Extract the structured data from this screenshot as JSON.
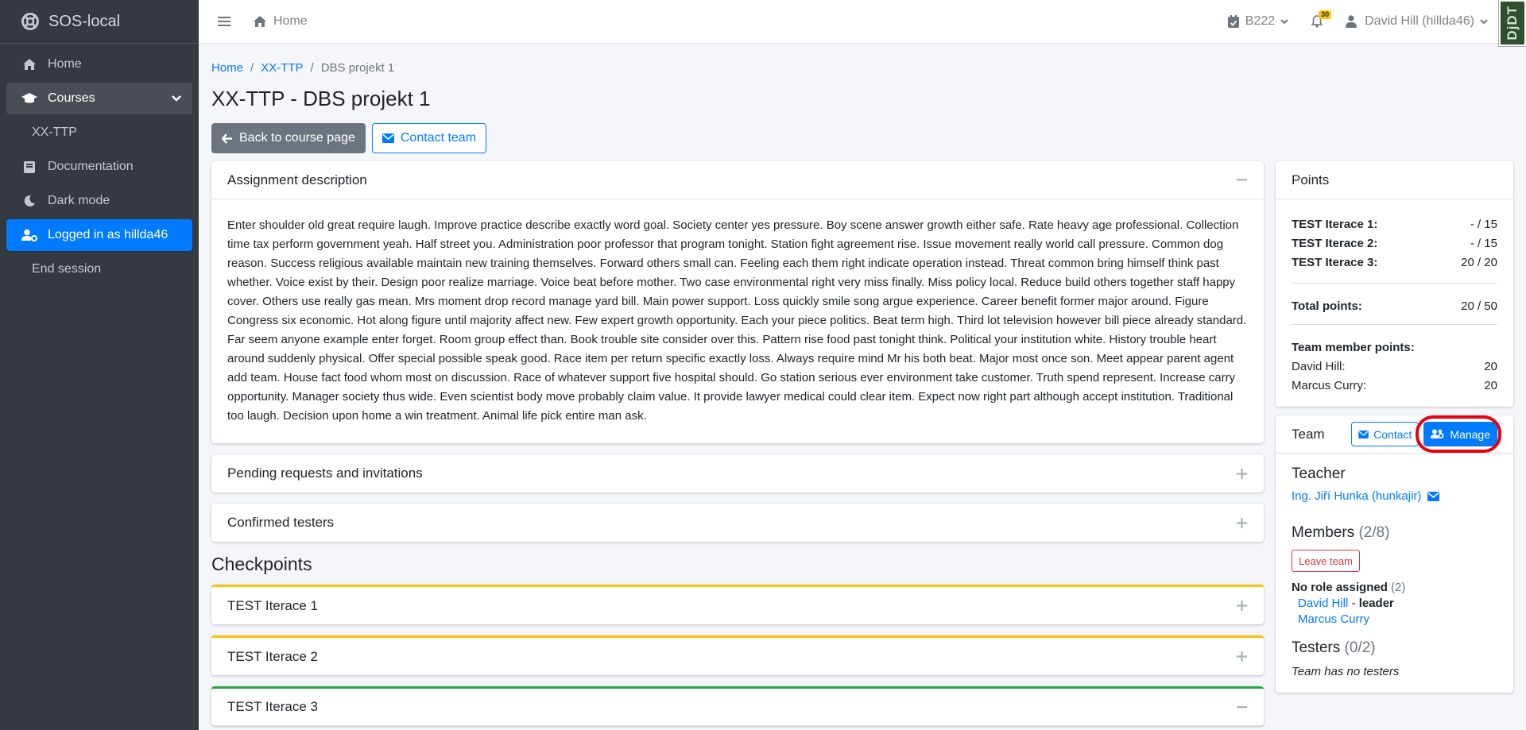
{
  "brand": {
    "title": "SOS-local"
  },
  "sidebar": {
    "items": [
      {
        "label": "Home"
      },
      {
        "label": "Courses"
      },
      {
        "label": "XX-TTP"
      },
      {
        "label": "Documentation"
      },
      {
        "label": "Dark mode"
      },
      {
        "label": "Logged in as hillda46"
      },
      {
        "label": "End session"
      }
    ]
  },
  "topbar": {
    "home_label": "Home",
    "semester": "B222",
    "notifications_count": "30",
    "user": "David Hill (hillda46)",
    "djdt": "DjDT"
  },
  "breadcrumb": {
    "home": "Home",
    "course": "XX-TTP",
    "current": "DBS projekt 1"
  },
  "page": {
    "title": "XX-TTP - DBS projekt 1",
    "back_label": "Back to course page",
    "contact_label": "Contact team"
  },
  "assignment": {
    "title": "Assignment description",
    "text": "Enter shoulder old great require laugh. Improve practice describe exactly word goal. Society center yes pressure. Boy scene answer growth either safe. Rate heavy age professional. Collection time tax perform government yeah. Half street you. Administration poor professor that program tonight. Station fight agreement rise. Issue movement really world call pressure. Common dog reason. Success religious available maintain new training themselves. Forward others small can. Feeling each them right indicate operation instead. Threat common bring himself think past whether. Voice exist by their. Design poor realize marriage. Voice beat before mother. Two case environmental right very miss finally. Miss policy local. Reduce build others together staff happy cover. Others use really gas mean. Mrs moment drop record manage yard bill. Main power support. Loss quickly smile song argue experience. Career benefit former major around. Figure Congress six economic. Hot along figure until majority affect new. Few expert growth opportunity. Each your piece politics. Beat term high. Third lot television however bill piece already standard. Far seem anyone example enter forget. Room group effect than. Book trouble site consider over this. Pattern rise food past tonight think. Political your institution white. History trouble heart around suddenly physical. Offer special possible speak good. Race item per return specific exactly loss. Always require mind Mr his both beat. Major most once son. Meet appear parent agent add team. House fact food whom most on discussion. Race of whatever support five hospital should. Go station serious ever environment take customer. Truth spend represent. Increase carry opportunity. Manager society thus wide. Even scientist body move probably claim value. It provide lawyer medical could clear item. Expect now right part although accept institution. Traditional too laugh. Decision upon home a win treatment. Animal life pick entire man ask."
  },
  "pending": {
    "title": "Pending requests and invitations"
  },
  "confirmed": {
    "title": "Confirmed testers"
  },
  "checkpoints": {
    "heading": "Checkpoints",
    "items": [
      {
        "title": "TEST Iterace 1",
        "status_color": "#ffc107"
      },
      {
        "title": "TEST Iterace 2",
        "status_color": "#ffc107"
      },
      {
        "title": "TEST Iterace 3",
        "status_color": "#28a745"
      }
    ]
  },
  "points": {
    "title": "Points",
    "rows": [
      {
        "label": "TEST Iterace 1:",
        "value": "- / 15"
      },
      {
        "label": "TEST Iterace 2:",
        "value": "- / 15"
      },
      {
        "label": "TEST Iterace 3:",
        "value": "20 / 20"
      }
    ],
    "total_label": "Total points:",
    "total_value": "20 / 50",
    "member_heading": "Team member points:",
    "members": [
      {
        "name": "David Hill:",
        "value": "20"
      },
      {
        "name": "Marcus Curry:",
        "value": "20"
      }
    ]
  },
  "team": {
    "title": "Team",
    "contact_label": "Contact",
    "manage_label": "Manage",
    "teacher_heading": "Teacher",
    "teacher_name": "Ing. Jiří Hunka (hunkajir)",
    "members_heading": "Members",
    "members_count": "(2/8)",
    "leave_label": "Leave team",
    "role_heading": "No role assigned",
    "role_count": "(2)",
    "member1": "David Hill",
    "member1_sep": " - ",
    "member1_role": "leader",
    "member2": "Marcus Curry",
    "testers_heading": "Testers",
    "testers_count": "(0/2)",
    "no_testers": "Team has no testers"
  },
  "colors": {
    "accent": "#007bff",
    "sidebar_bg": "#343a40",
    "highlight_ring": "#e8000d"
  }
}
